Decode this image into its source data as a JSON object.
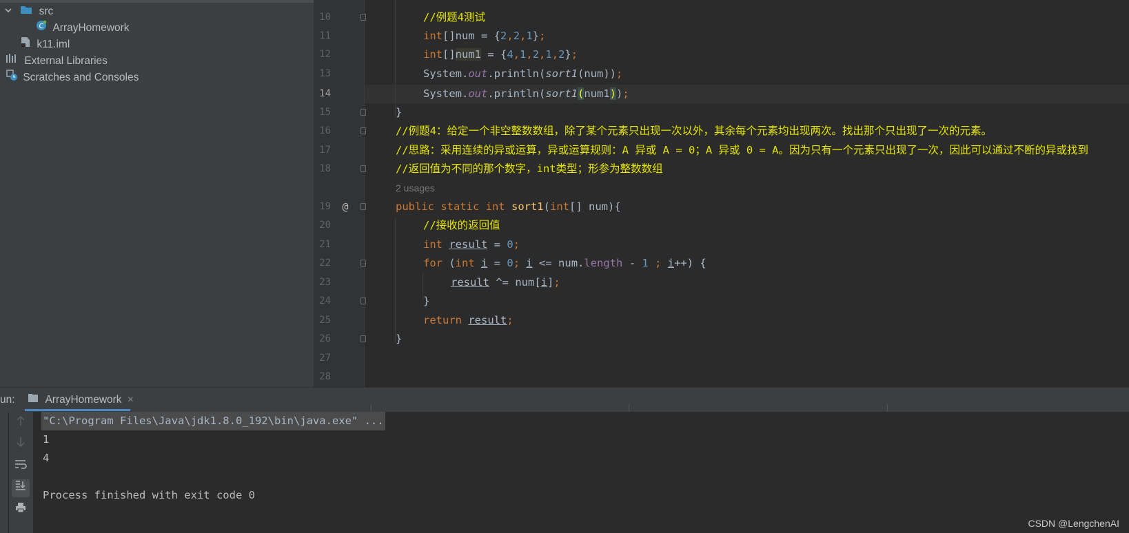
{
  "project": {
    "items": [
      {
        "label": "src",
        "icon": "folder-icon"
      },
      {
        "label": "ArrayHomework",
        "icon": "java-class-icon"
      },
      {
        "label": "k11.iml",
        "icon": "iml-file-icon"
      },
      {
        "label": "External Libraries",
        "icon": "libraries-icon"
      },
      {
        "label": "Scratches and Consoles",
        "icon": "scratches-icon"
      }
    ]
  },
  "editor": {
    "line_numbers": [
      "10",
      "11",
      "12",
      "13",
      "14",
      "15",
      "16",
      "17",
      "18",
      "19",
      "20",
      "21",
      "22",
      "23",
      "24",
      "25",
      "26",
      "27",
      "28"
    ],
    "usages_hint": "2 usages",
    "gutter_marker": "@",
    "lines": {
      "l10": "//例题4测试",
      "l16": "//例题4：给定一个非空整数数组，除了某个元素只出现一次以外，其余每个元素均出现两次。找出那个只出现了一次的元素。",
      "l17": "//思路：采用连续的异或运算，异或运算规则：A 异或 A = 0；A 异或 0 = A。因为只有一个元素只出现了一次，因此可以通过不断的异或找到",
      "l18": "//返回值为不同的那个数字，int类型；形参为整数数组",
      "l20": "//接收的返回值"
    }
  },
  "run": {
    "label": "un:",
    "tab_label": "ArrayHomework",
    "close_glyph": "×"
  },
  "console": {
    "command": "\"C:\\Program Files\\Java\\jdk1.8.0_192\\bin\\java.exe\" ...",
    "output": [
      "1",
      "4",
      "",
      "Process finished with exit code 0"
    ]
  },
  "watermark": "CSDN @LengchenAI"
}
